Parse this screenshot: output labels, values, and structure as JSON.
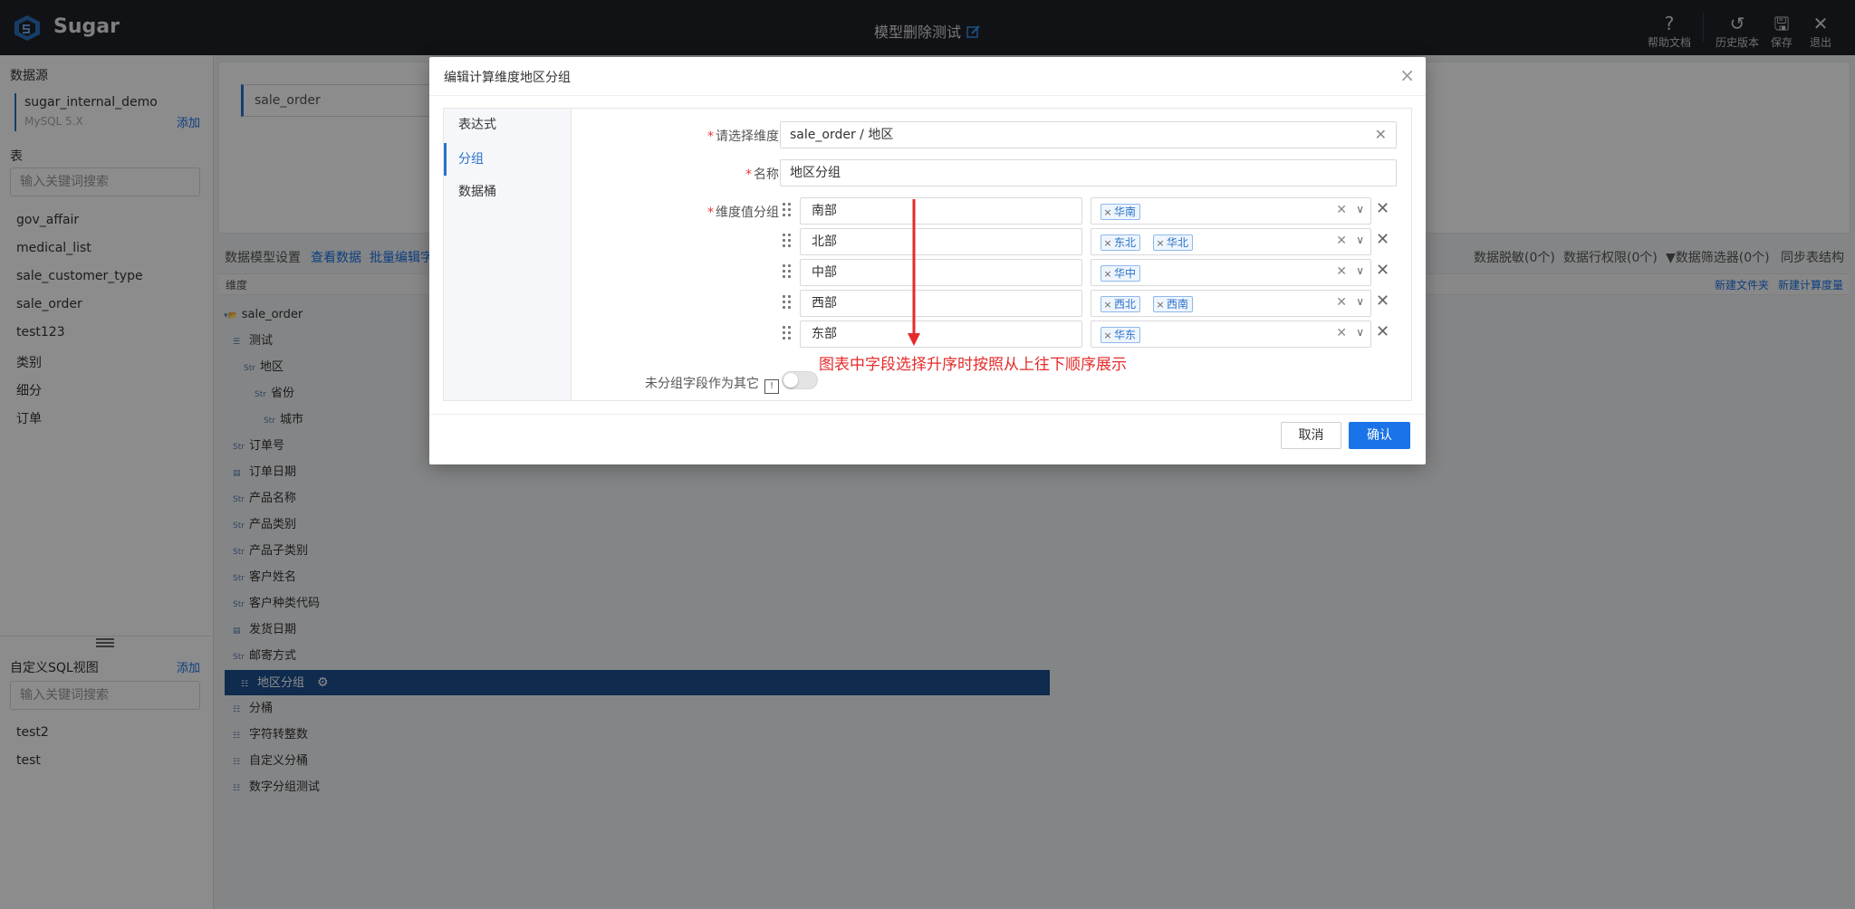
{
  "app": {
    "name": "Sugar",
    "page_title": "模型删除测试"
  },
  "toolbar": {
    "help": "帮助文档",
    "history": "历史版本",
    "save": "保存",
    "exit": "退出"
  },
  "left": {
    "datasource_label": "数据源",
    "datasource_name": "sugar_internal_demo",
    "datasource_type": "MySQL 5.X",
    "add_label": "添加",
    "tables_label": "表",
    "search_placeholder": "输入关键词搜索",
    "tables": [
      "gov_affair",
      "medical_list",
      "sale_customer_type",
      "sale_order",
      "test123",
      "类别",
      "细分",
      "订单"
    ],
    "sql_label": "自定义SQL视图",
    "sql_add": "添加",
    "sql_search_placeholder": "输入关键词搜索",
    "sql_views": [
      "test2",
      "test"
    ]
  },
  "main": {
    "selected_table": "sale_order",
    "tabs": {
      "settings": "数据模型设置",
      "view_data": "查看数据",
      "batch_edit": "批量编辑字"
    },
    "right_tools": {
      "masking": "数据脱敏(0个)",
      "row_permission": "数据行权限(0个)",
      "filter": "数据筛选器(0个)",
      "sync": "同步表结构"
    },
    "dim_header": "维度",
    "new_folder": "新建文件夹",
    "new_calc": "新建计算度量",
    "tree": [
      {
        "label": "sale_order",
        "icon": "folder-icon",
        "type": ""
      },
      {
        "label": "测试",
        "icon": "hierarchy-icon",
        "type": ""
      },
      {
        "label": "地区",
        "icon": "string-type-icon",
        "type": "Str"
      },
      {
        "label": "省份",
        "icon": "string-type-icon",
        "type": "Str"
      },
      {
        "label": "城市",
        "icon": "string-type-icon",
        "type": "Str"
      },
      {
        "label": "订单号",
        "icon": "string-type-icon",
        "type": "Str"
      },
      {
        "label": "订单日期",
        "icon": "date-type-icon",
        "type": ""
      },
      {
        "label": "产品名称",
        "icon": "string-type-icon",
        "type": "Str"
      },
      {
        "label": "产品类别",
        "icon": "string-type-icon",
        "type": "Str"
      },
      {
        "label": "产品子类别",
        "icon": "string-type-icon",
        "type": "Str"
      },
      {
        "label": "客户姓名",
        "icon": "string-type-icon",
        "type": "Str"
      },
      {
        "label": "客户种类代码",
        "icon": "string-type-icon",
        "type": "Str"
      },
      {
        "label": "发货日期",
        "icon": "date-type-icon",
        "type": ""
      },
      {
        "label": "邮寄方式",
        "icon": "string-type-icon",
        "type": "Str"
      },
      {
        "label": "地区分组",
        "icon": "group-field-icon",
        "type": ""
      },
      {
        "label": "分桶",
        "icon": "group-field-icon",
        "type": ""
      },
      {
        "label": "字符转整数",
        "icon": "group-field-icon",
        "type": ""
      },
      {
        "label": "自定义分桶",
        "icon": "group-field-icon",
        "type": ""
      },
      {
        "label": "数字分组测试",
        "icon": "group-field-icon",
        "type": ""
      }
    ]
  },
  "modal": {
    "title": "编辑计算维度地区分组",
    "nav": [
      "表达式",
      "分组",
      "数据桶"
    ],
    "active_nav": "分组",
    "dimension_label": "请选择维度",
    "dimension_value": "sale_order / 地区",
    "name_label": "名称",
    "name_value": "地区分组",
    "groups_label": "维度值分组",
    "groups": [
      {
        "name": "南部",
        "values": [
          "华南"
        ]
      },
      {
        "name": "北部",
        "values": [
          "东北",
          "华北"
        ]
      },
      {
        "name": "中部",
        "values": [
          "华中"
        ]
      },
      {
        "name": "西部",
        "values": [
          "西北",
          "西南"
        ]
      },
      {
        "name": "东部",
        "values": [
          "华东"
        ]
      }
    ],
    "annotation": "图表中字段选择升序时按照从上往下顺序展示",
    "ungrouped_label": "未分组字段作为其它",
    "ungrouped_enabled": false,
    "cancel": "取消",
    "confirm": "确认"
  },
  "colors": {
    "accent": "#1a73e8",
    "selected_row": "#1c4f8f",
    "annotation": "#e62b2b",
    "topbar": "#1f2228"
  }
}
